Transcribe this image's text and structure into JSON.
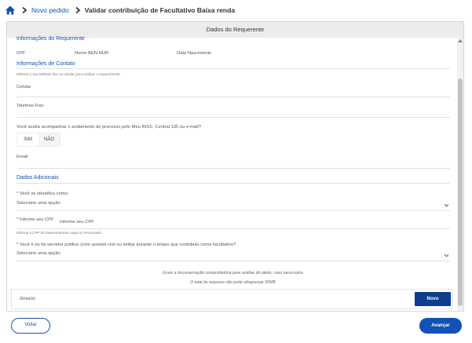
{
  "breadcrumb": {
    "home_icon": "home-icon",
    "link": "Novo pedido",
    "current": "Validar contribuição de Facultativo Baixa renda"
  },
  "panel": {
    "header": "Dados do Requerente"
  },
  "requerente": {
    "title": "Informações do Requerente",
    "cpf_label": "CPF",
    "nome_label": "Nome BEN HUR",
    "nascimento_label": "Data Nascimento"
  },
  "contato": {
    "title": "Informações de Contato",
    "hint": "Informe o seu telefone fixo ou celular para realizar o requerimento",
    "celular_label": "Celular",
    "telefone_label": "Telefone Fixo",
    "question": "Você aceita acompanhar o andamento do processo pelo Meu INSS, Central 135 ou e-mail?",
    "sim": "SIM",
    "nao": "NÃO",
    "email_label": "Email"
  },
  "adicionais": {
    "title": "Dados Adicionais",
    "identifica_label": "* Você se identifica como:",
    "identifica_value": "Selecione uma opção",
    "cpf_label": "* Informe seu CPF",
    "cpf_placeholder": "Informe seu CPF",
    "cpf_hint": "Informe o CPF do Representante Legal ou Procurador",
    "servidor_label": "* Você é ou foi servidor público (com acentol civil ou militar durante o tempo que contribuiu como facultativo?",
    "servidor_value": "Selecione uma opção"
  },
  "anexos": {
    "info1": "Envie a documentação comprobatória para análise do pleito, caso necessário",
    "info2": "O total de arquivos não pode ultrapassar 50MB",
    "label": "Anexos",
    "novo": "Novo"
  },
  "footer": {
    "voltar": "Voltar",
    "avancar": "Avançar"
  },
  "colors": {
    "primary": "#1351b4",
    "dark_button": "#0c3d8f",
    "header_bg": "#ececec"
  }
}
